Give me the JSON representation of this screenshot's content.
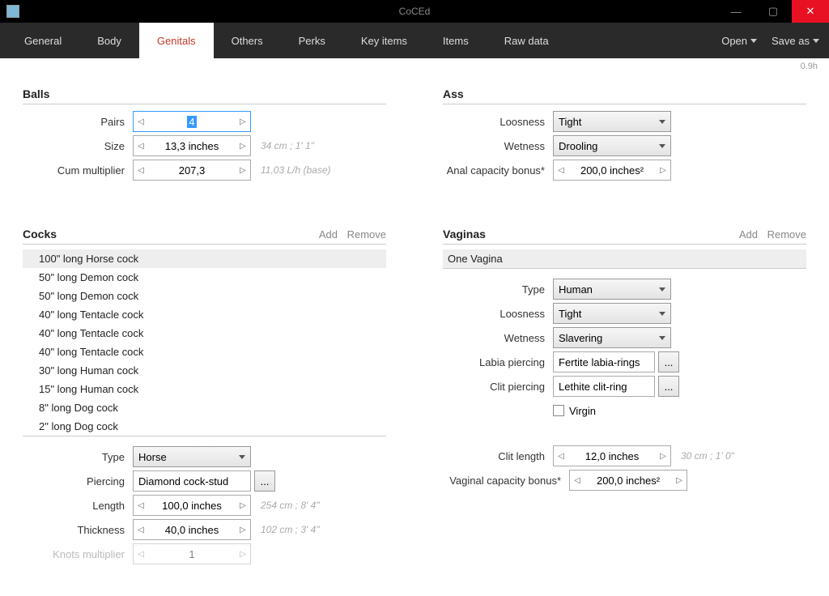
{
  "app": {
    "title": "CoCEd"
  },
  "menu": {
    "tabs": [
      "General",
      "Body",
      "Genitals",
      "Others",
      "Perks",
      "Key items",
      "Items",
      "Raw data"
    ],
    "activeTab": "Genitals",
    "open": "Open",
    "saveas": "Save as"
  },
  "version": "0.9h",
  "balls": {
    "title": "Balls",
    "pairs_label": "Pairs",
    "pairs_val": "4",
    "size_label": "Size",
    "size_val": "13,3 inches",
    "size_hint": "34 cm ; 1' 1\"",
    "cum_label": "Cum multiplier",
    "cum_val": "207,3",
    "cum_hint": "11,03 L/h (base)"
  },
  "ass": {
    "title": "Ass",
    "loos_label": "Loosness",
    "loos_val": "Tight",
    "wet_label": "Wetness",
    "wet_val": "Drooling",
    "cap_label": "Anal capacity bonus*",
    "cap_val": "200,0 inches²"
  },
  "cocks": {
    "title": "Cocks",
    "add": "Add",
    "remove": "Remove",
    "items": [
      "100\" long Horse cock",
      "50\" long Demon cock",
      "50\" long Demon cock",
      "40\" long Tentacle cock",
      "40\" long Tentacle cock",
      "40\" long Tentacle cock",
      "30\" long Human cock",
      "15\" long Human cock",
      "8\" long Dog cock",
      "2\" long Dog cock"
    ],
    "type_label": "Type",
    "type_val": "Horse",
    "pierce_label": "Piercing",
    "pierce_val": "Diamond cock-stud",
    "len_label": "Length",
    "len_val": "100,0 inches",
    "len_hint": "254 cm ; 8' 4\"",
    "thk_label": "Thickness",
    "thk_val": "40,0 inches",
    "thk_hint": "102 cm ; 3' 4\"",
    "knot_label": "Knots multiplier",
    "knot_val": "1"
  },
  "vaginas": {
    "title": "Vaginas",
    "add": "Add",
    "remove": "Remove",
    "items": [
      "One Vagina"
    ],
    "type_label": "Type",
    "type_val": "Human",
    "loos_label": "Loosness",
    "loos_val": "Tight",
    "wet_label": "Wetness",
    "wet_val": "Slavering",
    "labia_label": "Labia piercing",
    "labia_val": "Fertite labia-rings",
    "clit_label": "Clit piercing",
    "clit_val": "Lethite clit-ring",
    "virgin_label": "Virgin",
    "clitlen_label": "Clit length",
    "clitlen_val": "12,0 inches",
    "clitlen_hint": "30 cm ; 1' 0\"",
    "cap_label": "Vaginal capacity bonus*",
    "cap_val": "200,0 inches²"
  },
  "glyph": {
    "left": "◁",
    "right": "▷",
    "more": "..."
  }
}
